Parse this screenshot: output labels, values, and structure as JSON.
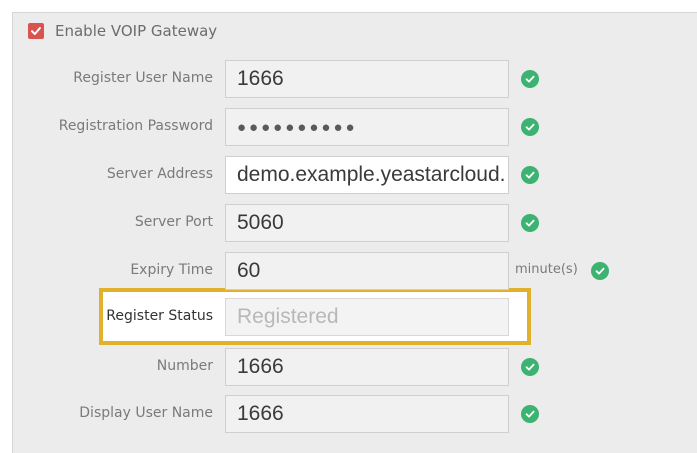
{
  "gateway": {
    "enable_label": "Enable VOIP Gateway",
    "enabled": true
  },
  "fields": {
    "register_user_name": {
      "label": "Register User Name",
      "value": "1666"
    },
    "registration_password": {
      "label": "Registration Password",
      "value": "●●●●●●●●●●"
    },
    "server_address": {
      "label": "Server Address",
      "value": "demo.example.yeastarcloud."
    },
    "server_port": {
      "label": "Server Port",
      "value": "5060"
    },
    "expiry_time": {
      "label": "Expiry Time",
      "value": "60",
      "unit": "minute(s)"
    },
    "register_status": {
      "label": "Register Status",
      "value": "Registered"
    },
    "number": {
      "label": "Number",
      "value": "1666"
    },
    "display_user_name": {
      "label": "Display User Name",
      "value": "1666"
    }
  },
  "colors": {
    "checkbox": "#d9534f",
    "valid": "#3cb371",
    "highlight": "#e1b12c"
  },
  "icons": {
    "checkbox": "check-icon",
    "valid": "check-circle-icon"
  }
}
